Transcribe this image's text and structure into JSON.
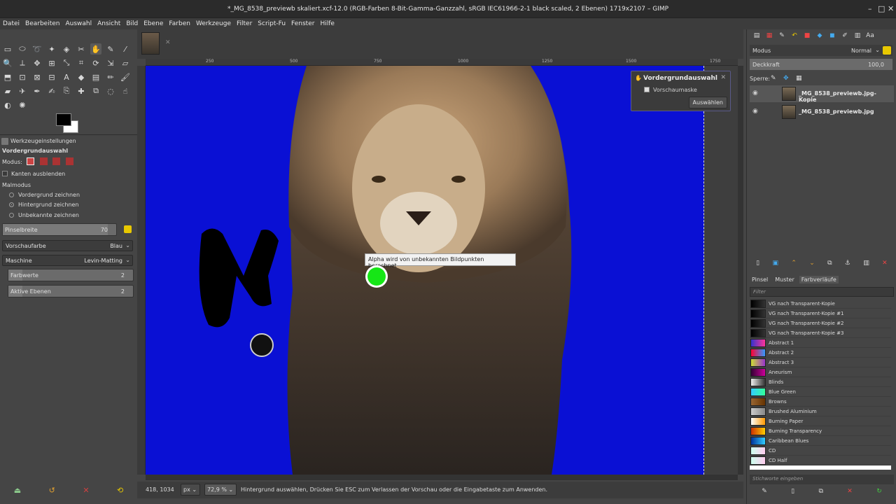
{
  "window": {
    "title": "*_MG_8538_previewb skaliert.xcf-12.0 (RGB-Farben 8-Bit-Gamma-Ganzzahl, sRGB IEC61966-2-1 black scaled, 2 Ebenen) 1719x2107 – GIMP",
    "min": "–",
    "max": "□",
    "close": "✕"
  },
  "menu": [
    "Datei",
    "Bearbeiten",
    "Auswahl",
    "Ansicht",
    "Bild",
    "Ebene",
    "Farben",
    "Werkzeuge",
    "Filter",
    "Script-Fu",
    "Fenster",
    "Hilfe"
  ],
  "tooloptions": {
    "tab_label": "Werkzeugeinstellungen",
    "tool_name": "Vordergrundauswahl",
    "mode_label": "Modus:",
    "hide_edges": "Kanten ausblenden",
    "paint_mode_label": "Malmodus",
    "radio_fg": "Vordergrund zeichnen",
    "radio_bg": "Hintergrund zeichnen",
    "radio_unknown": "Unbekannte zeichnen",
    "brush_label": "Pinselbreite",
    "brush_value": "70",
    "preview_color_label": "Vorschaufarbe",
    "preview_color_value": "Blau",
    "engine_label": "Maschine",
    "engine_value": "Levin-Matting",
    "levels_label": "Farbwerte",
    "levels_value": "2",
    "active_levels_label": "Aktive Ebenen",
    "active_levels_value": "2"
  },
  "ruler_ticks": [
    "250",
    "500",
    "750",
    "1000",
    "1250",
    "1500",
    "1750"
  ],
  "fgselect_popup": {
    "title": "Vordergrundauswahl",
    "checkbox": "Vorschaumaske",
    "button": "Auswählen"
  },
  "tooltip": {
    "text": "Alpha wird von unbekannten Bildpunkten berechnet"
  },
  "statusbar": {
    "coords": "418, 1034",
    "unit": "px",
    "zoom": "72,9 %",
    "message": "Hintergrund auswählen, Drücken Sie ESC zum Verlassen der Vorschau oder die Eingabetaste zum Anwenden."
  },
  "layers": {
    "mode_label": "Modus",
    "mode_value": "Normal",
    "opacity_label": "Deckkraft",
    "opacity_value": "100,0",
    "lock_label": "Sperre:",
    "items": [
      {
        "name": "_MG_8538_previewb.jpg-Kopie",
        "selected": true
      },
      {
        "name": "_MG_8538_previewb.jpg",
        "selected": false
      }
    ]
  },
  "resources": {
    "tabs": [
      "Pinsel",
      "Muster",
      "Farbverläufe"
    ],
    "filter_placeholder": "Filter",
    "tag_placeholder": "Stichworte eingeben",
    "gradients": [
      {
        "name": "VG nach Transparent-Kopie",
        "colors": "#000000,#333333"
      },
      {
        "name": "VG nach Transparent-Kopie #1",
        "colors": "#000000,#333333"
      },
      {
        "name": "VG nach Transparent-Kopie #2",
        "colors": "#000000,#333333"
      },
      {
        "name": "VG nach Transparent-Kopie #3",
        "colors": "#000000,#333333"
      },
      {
        "name": "Abstract 1",
        "colors": "#3333cc,#ff3399"
      },
      {
        "name": "Abstract 2",
        "colors": "#ff0033,#3399ff"
      },
      {
        "name": "Abstract 3",
        "colors": "#ccdd33,#9933cc"
      },
      {
        "name": "Aneurism",
        "colors": "#330033,#cc0099"
      },
      {
        "name": "Blinds",
        "colors": "#eeeeee,#333333"
      },
      {
        "name": "Blue Green",
        "colors": "#33ccff,#33ff99"
      },
      {
        "name": "Browns",
        "colors": "#996633,#663300"
      },
      {
        "name": "Brushed Aluminium",
        "colors": "#cccccc,#888888"
      },
      {
        "name": "Burning Paper",
        "colors": "#ffffff,#ff9900"
      },
      {
        "name": "Burning Transparency",
        "colors": "#cc3300,#ffcc00"
      },
      {
        "name": "Caribbean Blues",
        "colors": "#003399,#33ccff"
      },
      {
        "name": "CD",
        "colors": "#ccffee,#ffccee"
      },
      {
        "name": "CD Half",
        "colors": "#ccffee,#ffccee"
      }
    ]
  }
}
